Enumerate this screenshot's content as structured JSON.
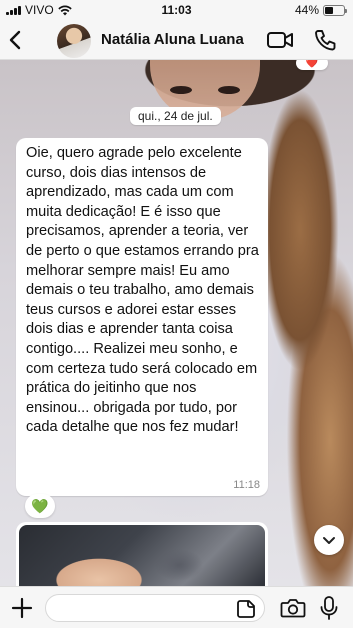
{
  "status_bar": {
    "carrier": "VIVO",
    "time": "11:03",
    "battery": "44%",
    "battery_level": 0.44
  },
  "header": {
    "contact_name": "Natália Aluna Luana"
  },
  "chat": {
    "date_chip": "qui., 24 de jul.",
    "message": {
      "text": "Oie, quero agrade pelo excelente curso, dois dias intensos de aprendizado, mas cada um com muita dedicação! E é isso que precisamos, aprender a teoria, ver de perto o que estamos errando pra melhorar sempre mais! Eu amo demais o teu trabalho, amo demais teus cursos e adorei estar esses dois dias e aprender tanta coisa contigo.... Realizei meu sonho, e com certeza tudo será colocado em prática do jeitinho que nos ensinou... obrigada por tudo, por cada detalhe que nos fez mudar!",
      "time": "11:18",
      "reaction": "💚"
    },
    "top_reaction": "❤️"
  },
  "input_bar": {
    "placeholder": ""
  },
  "icons": {
    "back": "chevron-left-icon",
    "video": "video-camera-icon",
    "call": "phone-icon",
    "plus": "plus-icon",
    "sticker": "sticker-icon",
    "camera": "camera-icon",
    "mic": "microphone-icon",
    "scroll": "chevron-down-icon",
    "wifi": "wifi-icon",
    "signal": "signal-icon",
    "battery": "battery-icon"
  }
}
